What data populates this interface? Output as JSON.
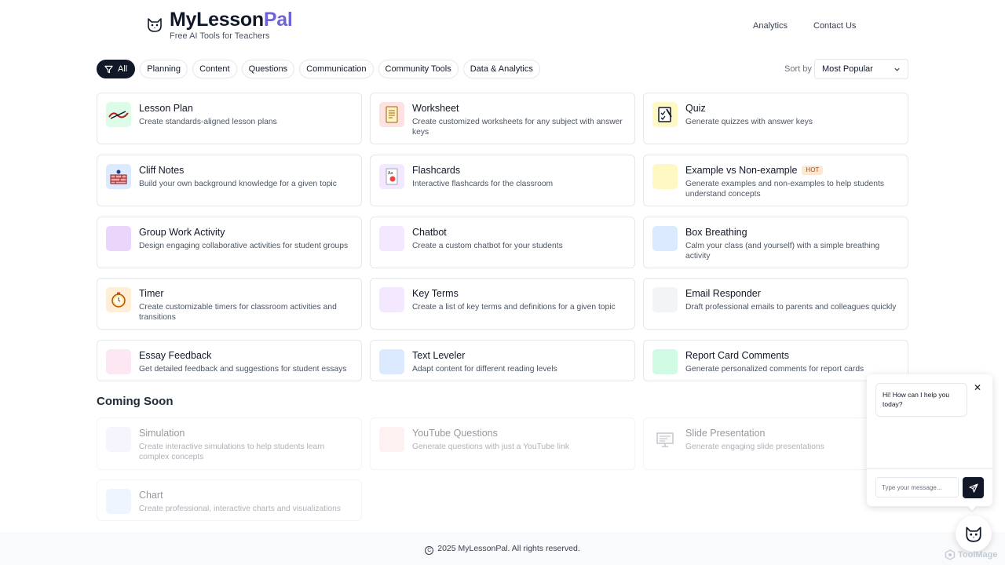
{
  "brand": {
    "name_main": "MyLesson",
    "name_accent": "Pal",
    "subtitle": "Free AI Tools for Teachers",
    "accent_color": "#6d63d8"
  },
  "nav": {
    "analytics": "Analytics",
    "contact": "Contact Us"
  },
  "filters": [
    "All",
    "Planning",
    "Content",
    "Questions",
    "Communication",
    "Community Tools",
    "Data & Analytics"
  ],
  "sort": {
    "label": "Sort by",
    "value": "Most Popular"
  },
  "tools": [
    {
      "title": "Lesson Plan",
      "desc": "Create standards-aligned lesson plans",
      "icon": "lesson-plan-icon",
      "bg": "#dcfce7"
    },
    {
      "title": "Worksheet",
      "desc": "Create customized worksheets for any subject with answer keys",
      "icon": "worksheet-icon",
      "bg": "#fee2e2"
    },
    {
      "title": "Quiz",
      "desc": "Generate quizzes with answer keys",
      "icon": "quiz-icon",
      "bg": "#fef9c3"
    },
    {
      "title": "Cliff Notes",
      "desc": "Build your own background knowledge for a given topic",
      "icon": "cliff-notes-icon",
      "bg": "#dbeafe"
    },
    {
      "title": "Flashcards",
      "desc": "Interactive flashcards for the classroom",
      "icon": "flashcards-icon",
      "bg": "#f3e8ff"
    },
    {
      "title": "Example vs Non-example",
      "badge": "HOT",
      "desc": "Generate examples and non-examples to help students understand concepts",
      "icon": "example-icon",
      "bg": "#fef9c3"
    },
    {
      "title": "Group Work Activity",
      "desc": "Design engaging collaborative activities for student groups",
      "icon": "group-work-icon",
      "bg": "#ead5fb"
    },
    {
      "title": "Chatbot",
      "desc": "Create a custom chatbot for your students",
      "icon": "chatbot-icon",
      "bg": "#f3e8ff"
    },
    {
      "title": "Box Breathing",
      "desc": "Calm your class (and yourself) with a simple breathing activity",
      "icon": "box-breathing-icon",
      "bg": "#dbeafe"
    },
    {
      "title": "Timer",
      "desc": "Create customizable timers for classroom activities and transitions",
      "icon": "timer-icon",
      "bg": "#ffedd5"
    },
    {
      "title": "Key Terms",
      "desc": "Create a list of key terms and definitions for a given topic",
      "icon": "key-terms-icon",
      "bg": "#f3e8ff"
    },
    {
      "title": "Email Responder",
      "desc": "Draft professional emails to parents and colleagues quickly",
      "icon": "email-icon",
      "bg": "#f3f4f6"
    },
    {
      "title": "Essay Feedback",
      "desc": "Get detailed feedback and suggestions for student essays",
      "icon": "essay-feedback-icon",
      "bg": "#fce7f3"
    },
    {
      "title": "Text Leveler",
      "desc": "Adapt content for different reading levels",
      "icon": "text-leveler-icon",
      "bg": "#dbeafe"
    },
    {
      "title": "Report Card Comments",
      "desc": "Generate personalized comments for report cards",
      "icon": "report-card-icon",
      "bg": "#d1fae5"
    }
  ],
  "coming_soon": {
    "title": "Coming Soon",
    "items": [
      {
        "title": "Simulation",
        "desc": "Create interactive simulations to help students learn complex concepts",
        "icon": "simulation-icon",
        "bg": "#ede9fe"
      },
      {
        "title": "YouTube Questions",
        "desc": "Generate questions with just a YouTube link",
        "icon": "youtube-icon",
        "bg": "#fee2e2"
      },
      {
        "title": "Slide Presentation",
        "desc": "Generate engaging slide presentations",
        "icon": "slide-presentation-icon",
        "bg": "#ffffff"
      },
      {
        "title": "Chart",
        "desc": "Create professional, interactive charts and visualizations",
        "icon": "chart-icon",
        "bg": "#dbeafe"
      }
    ]
  },
  "footer": {
    "text": "2025 MyLessonPal. All rights reserved."
  },
  "chat": {
    "greeting": "Hi! How can I help you today?",
    "placeholder": "Type your message..."
  },
  "watermark": "ToolMage"
}
